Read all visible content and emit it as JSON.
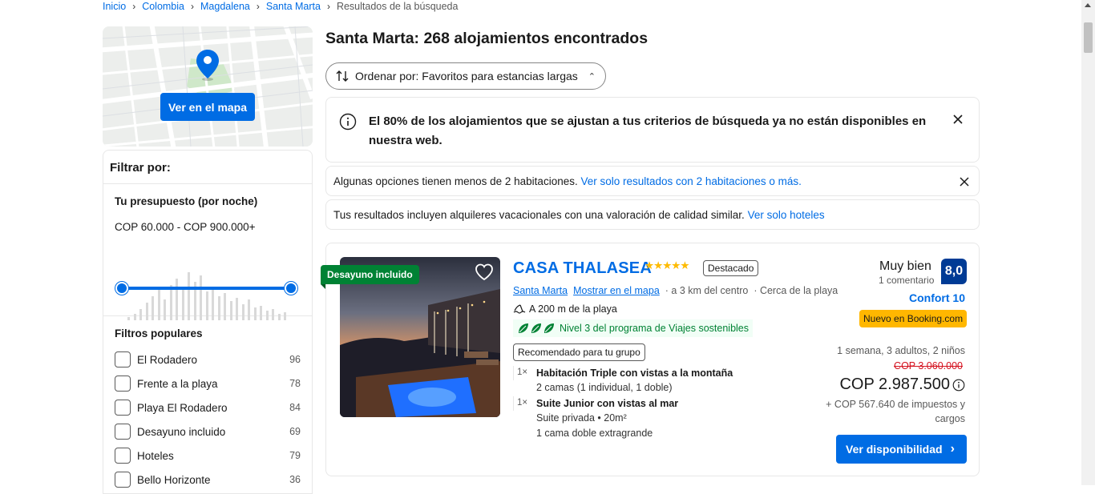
{
  "breadcrumb": {
    "items": [
      "Inicio",
      "Colombia",
      "Magdalena",
      "Santa Marta"
    ],
    "current": "Resultados de la búsqueda"
  },
  "map": {
    "button_label": "Ver en el mapa"
  },
  "filters": {
    "title": "Filtrar por:",
    "budget_title": "Tu presupuesto (por noche)",
    "budget_range": "COP 60.000 - COP 900.000+",
    "popular_title": "Filtros populares",
    "popular": [
      {
        "label": "El Rodadero",
        "count": "96"
      },
      {
        "label": "Frente a la playa",
        "count": "78"
      },
      {
        "label": "Playa El Rodadero",
        "count": "84"
      },
      {
        "label": "Desayuno incluido",
        "count": "69"
      },
      {
        "label": "Hoteles",
        "count": "79"
      },
      {
        "label": "Bello Horizonte",
        "count": "36"
      }
    ]
  },
  "results": {
    "title": "Santa Marta: 268 alojamientos encontrados",
    "sort_label": "Ordenar por: Favoritos para estancias largas"
  },
  "alerts": {
    "availability": "El 80% de los alojamientos que se ajustan a tus criterios de búsqueda ya no están disponibles en nuestra web.",
    "rooms_text": "Algunas opciones tienen menos de 2 habitaciones.",
    "rooms_link": "Ver solo resultados con 2 habitaciones o más.",
    "vacation_text": "Tus resultados incluyen alquileres vacacionales con una valoración de calidad similar.",
    "vacation_link": "Ver solo hoteles"
  },
  "property": {
    "badge": "Desayuno incluido",
    "name": "CASA THALASEA",
    "stars": "★★★★★",
    "tag": "Destacado",
    "city": "Santa Marta",
    "map_link": "Mostrar en el mapa",
    "distance": "a 3 km del centro",
    "beach": "Cerca de la playa",
    "beach_distance": "A 200 m de la playa",
    "sustainability": "Nivel 3 del programa de Viajes sostenibles",
    "recommended": "Recomendado para tu grupo",
    "rooms": [
      {
        "qty": "1×",
        "name": "Habitación Triple con vistas a la montaña",
        "details": [
          "2 camas (1 individual, 1 doble)"
        ]
      },
      {
        "qty": "1×",
        "name": "Suite Junior con vistas al mar",
        "details": [
          "Suite privada • 20m²",
          "1 cama doble extragrande"
        ]
      }
    ],
    "rating_word": "Muy bien",
    "rating_count": "1 comentario",
    "score": "8,0",
    "comfort": "Confort 10",
    "new_badge": "Nuevo en Booking.com",
    "stay": "1 semana, 3 adultos, 2 niños",
    "old_price": "COP 3.060.000",
    "price": "COP 2.987.500",
    "taxes": "+ COP 567.640 de impuestos y cargos",
    "cta": "Ver disponibilidad"
  },
  "colors": {
    "primary": "#006ce4",
    "score_bg": "#003b95",
    "green": "#008234",
    "yellow": "#ffb700",
    "star": "#febb02"
  }
}
